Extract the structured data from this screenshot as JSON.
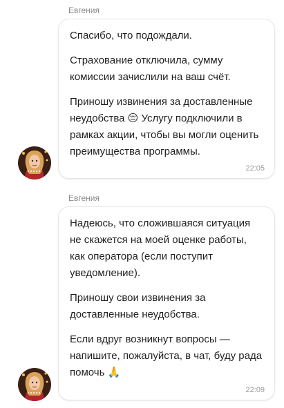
{
  "messages": [
    {
      "sender": "Евгения",
      "paragraphs": [
        "Спасибо, что подождали.",
        "Страхование отключила, сумму комиссии зачислили на ваш счёт.",
        "Приношу извинения за доставленные неудобства 😔 Услугу подключили в рамках акции, чтобы вы могли оценить преимущества программы."
      ],
      "time": "22:05"
    },
    {
      "sender": "Евгения",
      "paragraphs": [
        "Надеюсь, что сложившаяся ситуация не скажется на моей оценке работы, как оператора (если поступит уведомление).",
        "Приношу свои извинения за доставленные неудобства.",
        "Если вдруг возникнут вопросы — напишите, пожалуйста, в чат, буду рада помочь 🙏"
      ],
      "time": "22:09"
    }
  ]
}
